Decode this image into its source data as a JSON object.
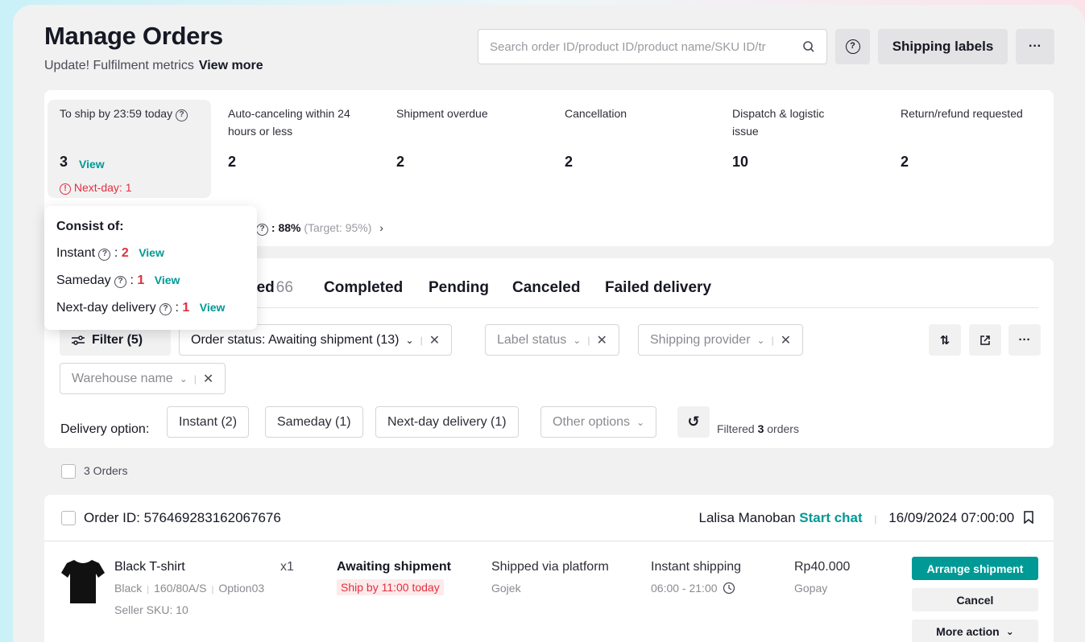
{
  "header": {
    "title": "Manage Orders",
    "subtitle": "Update! Fulfilment metrics",
    "view_more": "View more",
    "search_placeholder": "Search order ID/product ID/product name/SKU ID/tr",
    "help": "?",
    "shipping_labels": "Shipping labels",
    "more": "···"
  },
  "metrics": [
    {
      "label": "To ship by 23:59 today",
      "value": "3",
      "view": "View",
      "warning": "Next-day: 1"
    },
    {
      "label": "Auto-canceling within 24 hours or less",
      "value": "2"
    },
    {
      "label": "Shipment overdue",
      "value": "2"
    },
    {
      "label": "Cancellation",
      "value": "2"
    },
    {
      "label": "Dispatch & logistic issue",
      "value": "10"
    },
    {
      "label": "Return/refund requested",
      "value": "2"
    }
  ],
  "rate": {
    "value": ": 88%",
    "target": "(Target: 95%)"
  },
  "popover": {
    "title": "Consist of:",
    "items": [
      {
        "label": "Instant",
        "count": "2",
        "view": "View"
      },
      {
        "label": "Sameday",
        "count": "1",
        "view": "View"
      },
      {
        "label": "Next-day delivery",
        "count": "1",
        "view": "View"
      }
    ]
  },
  "tabs": [
    {
      "label": "ped",
      "count": "66"
    },
    {
      "label": "Completed"
    },
    {
      "label": "Pending"
    },
    {
      "label": "Canceled"
    },
    {
      "label": "Failed delivery"
    }
  ],
  "filters": {
    "filter_button": "Filter (5)",
    "order_status": "Order status: Awaiting shipment (13)",
    "label_status": "Label status",
    "shipping_provider": "Shipping provider",
    "warehouse_name": "Warehouse name"
  },
  "delivery": {
    "label": "Delivery option:",
    "options": [
      "Instant (2)",
      "Sameday (1)",
      "Next-day delivery (1)"
    ],
    "other": "Other options",
    "filtered_prefix": "Filtered",
    "filtered_count": "3",
    "filtered_suffix": "orders"
  },
  "orders_count": "3 Orders",
  "order": {
    "id": "Order ID: 576469283162067676",
    "buyer": "Lalisa Manoban",
    "start_chat": "Start chat",
    "datetime": "16/09/2024 07:00:00",
    "product_name": "Black T-shirt",
    "color": "Black",
    "size": "160/80A/S",
    "option": "Option03",
    "seller_sku": "Seller SKU: 10",
    "qty": "x1",
    "status": "Awaiting shipment",
    "ship_by": "Ship by 11:00 today",
    "shipped_via": "Shipped via platform",
    "carrier": "Gojek",
    "shipping_type": "Instant shipping",
    "time_window": "06:00 - 21:00",
    "price": "Rp40.000",
    "payment": "Gopay",
    "arrange": "Arrange shipment",
    "cancel": "Cancel",
    "more_action": "More action"
  },
  "colors": {
    "accent": "#009995",
    "danger": "#e0303f"
  }
}
